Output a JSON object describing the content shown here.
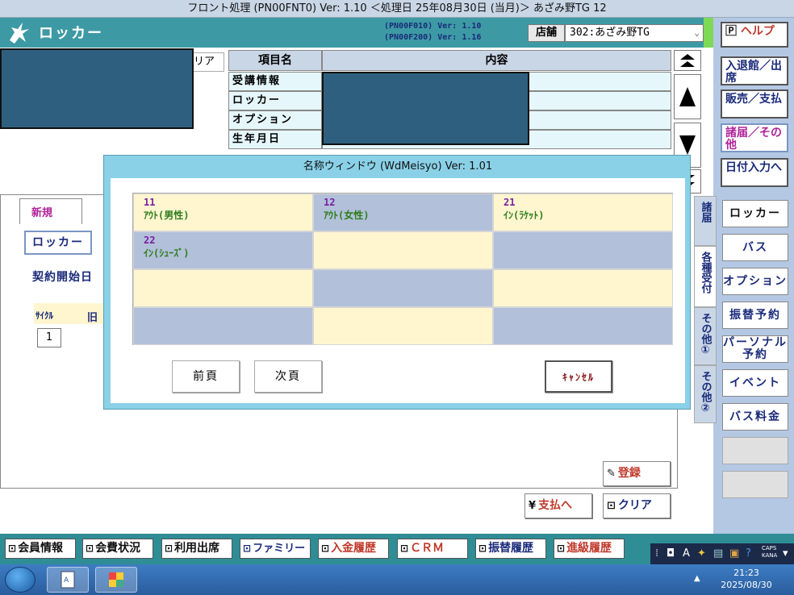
{
  "window_title": "フロント処理 (PN00FNT0) Ver: 1.10 ＜処理日 25年08月30日 (当月)＞ あざみ野TG 12",
  "header": {
    "app_name": "ロッカー",
    "version_line1": "(PN00F010)  Ver: 1.10",
    "version_line2": "(PN00F200)  Ver: 1.16",
    "store_label": "店舗",
    "store_value": "302:あざみ野TG"
  },
  "right_buttons": [
    {
      "label": "ヘルプ",
      "icon": "help-icon"
    },
    {
      "label": "入退館／出席"
    },
    {
      "label": "販売／支払"
    },
    {
      "label": "諸届／その他"
    },
    {
      "label": "日付入力へ"
    }
  ],
  "side_tabs": [
    "諸届",
    "各種受付",
    "その他①",
    "その他②"
  ],
  "sub_buttons": [
    "ロッカー",
    "バス",
    "オプション",
    "振替予約",
    "パーソナル予約",
    "イベント",
    "バス料金",
    "",
    ""
  ],
  "grid": {
    "headers": [
      "項目名",
      "内容"
    ],
    "rows": [
      "受講情報",
      "ロッカー",
      "オプション",
      "生年月日"
    ]
  },
  "top_clear": "リア",
  "left_panel": {
    "tab_new": "新規",
    "locker_button": "ロッカー",
    "contract_label": "契約開始日",
    "cycle_label": "ｻｲｸﾙ",
    "old_label": "旧",
    "cycle_value": "1"
  },
  "actions": {
    "register": "登録",
    "pay": "支払へ",
    "clear": "クリア"
  },
  "modal": {
    "title": "名称ウィンドウ (WdMeisyo) Ver: 1.01",
    "cells": [
      {
        "code": "11",
        "name": "ｱｳﾄ(男性)"
      },
      {
        "code": "12",
        "name": "ｱｳﾄ(女性)"
      },
      {
        "code": "21",
        "name": "ｲﾝ(ﾗｹｯﾄ)"
      },
      {
        "code": "22",
        "name": "ｲﾝ(ｼｭｰｽﾞ)"
      },
      {
        "code": "",
        "name": ""
      },
      {
        "code": "",
        "name": ""
      },
      {
        "code": "",
        "name": ""
      },
      {
        "code": "",
        "name": ""
      },
      {
        "code": "",
        "name": ""
      },
      {
        "code": "",
        "name": ""
      },
      {
        "code": "",
        "name": ""
      },
      {
        "code": "",
        "name": ""
      }
    ],
    "prev_label": "前頁",
    "next_label": "次頁",
    "cancel_label": "ｷｬﾝｾﾙ"
  },
  "function_buttons": [
    "会員情報",
    "会費状況",
    "利用出席",
    "ファミリー",
    "入金履歴",
    "ＣＲＭ",
    "振替履歴",
    "進級履歴"
  ],
  "taskbar": {
    "time": "21:23",
    "date": "2025/08/30",
    "caps": "CAPS",
    "kana": "KANA",
    "ime": "A"
  }
}
